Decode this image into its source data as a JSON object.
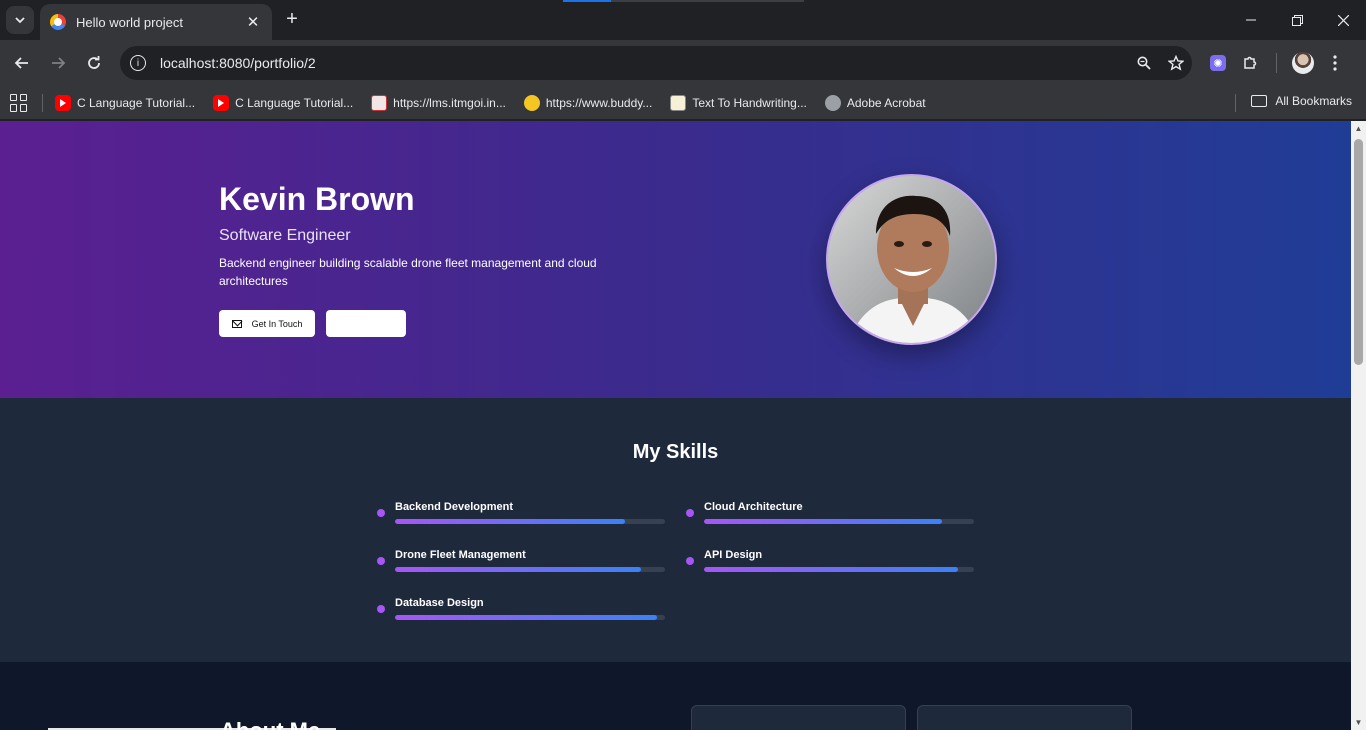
{
  "browser": {
    "tab_title": "Hello world project",
    "new_tab": "+",
    "url": "localhost:8080/portfolio/2",
    "bookmarks": [
      {
        "label": "C Language Tutorial...",
        "icon": "youtube-icon"
      },
      {
        "label": "C Language Tutorial...",
        "icon": "youtube-icon"
      },
      {
        "label": "https://lms.itmgoi.in...",
        "icon": "lms-icon"
      },
      {
        "label": "https://www.buddy...",
        "icon": "buddy-icon"
      },
      {
        "label": "Text To Handwriting...",
        "icon": "notepad-icon"
      },
      {
        "label": "Adobe Acrobat",
        "icon": "globe-icon"
      }
    ],
    "all_bookmarks": "All Bookmarks"
  },
  "hero": {
    "name": "Kevin Brown",
    "role": "Software Engineer",
    "description": "Backend engineer building scalable drone fleet management and cloud architectures",
    "contact_button": "Get In Touch",
    "secondary_button": "",
    "gradient_start": "#5b1f91",
    "gradient_end": "#203d96"
  },
  "skills": {
    "title": "My Skills",
    "items": [
      {
        "name": "Backend Development",
        "level": 0.85
      },
      {
        "name": "Cloud Architecture",
        "level": 0.88
      },
      {
        "name": "Drone Fleet Management",
        "level": 0.91
      },
      {
        "name": "API Design",
        "level": 0.94
      },
      {
        "name": "Database Design",
        "level": 0.97
      }
    ],
    "accent_start": "#a855f7",
    "accent_end": "#3b82f6"
  },
  "about": {
    "title": "About Me"
  }
}
